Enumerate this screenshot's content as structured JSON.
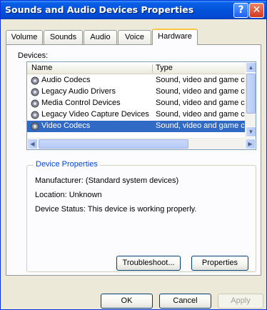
{
  "window": {
    "title": "Sounds and Audio Devices Properties",
    "help_glyph": "?",
    "close_glyph": "✕"
  },
  "tabs": [
    {
      "label": "Volume"
    },
    {
      "label": "Sounds"
    },
    {
      "label": "Audio"
    },
    {
      "label": "Voice"
    },
    {
      "label": "Hardware",
      "active": true
    }
  ],
  "devices": {
    "label": "Devices:",
    "columns": {
      "name": "Name",
      "type": "Type"
    },
    "rows": [
      {
        "name": "Audio Codecs",
        "type": "Sound, video and game contro",
        "icon": "audio-codec-icon"
      },
      {
        "name": "Legacy Audio Drivers",
        "type": "Sound, video and game contro",
        "icon": "audio-codec-icon"
      },
      {
        "name": "Media Control Devices",
        "type": "Sound, video and game contro",
        "icon": "audio-codec-icon"
      },
      {
        "name": "Legacy Video Capture Devices",
        "type": "Sound, video and game contro",
        "icon": "audio-codec-icon"
      },
      {
        "name": "Video Codecs",
        "type": "Sound, video and game contro",
        "icon": "audio-codec-icon",
        "selected": true
      }
    ]
  },
  "device_properties": {
    "title": "Device Properties",
    "manufacturer": "Manufacturer: (Standard system devices)",
    "location": "Location: Unknown",
    "status": "Device Status: This device is working properly."
  },
  "buttons": {
    "troubleshoot": "Troubleshoot...",
    "properties": "Properties",
    "ok": "OK",
    "cancel": "Cancel",
    "apply": "Apply"
  },
  "colors": {
    "titlebar": "#0353db",
    "selection": "#316ac5",
    "active_tab_accent": "#ffc83c",
    "group_title": "#0046d5"
  }
}
